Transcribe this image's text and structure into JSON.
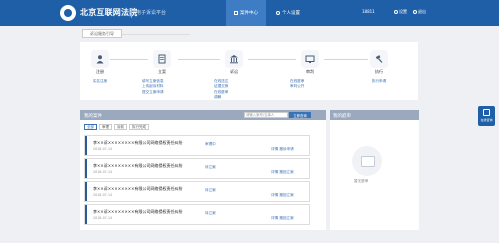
{
  "header": {
    "court_name": "北京互联网法院",
    "platform": "电子诉讼平台",
    "tabs": [
      "案件中心",
      "个人设置"
    ],
    "account": "18811",
    "links": [
      "设置",
      "退出"
    ]
  },
  "guide": {
    "tab_label": "诉讼服务引导"
  },
  "steps": [
    {
      "title": "注册",
      "desc": "实名注册"
    },
    {
      "title": "立案",
      "desc": "填写立案信息\n上传起诉材料\n提交立案申请"
    },
    {
      "title": "诉讼",
      "desc": "在线送达\n证据交换\n在线庭审\n调解"
    },
    {
      "title": "审判",
      "desc": "在线庭审\n审判公开"
    },
    {
      "title": "执行",
      "desc": "执行申请"
    }
  ],
  "cases": {
    "title": "我的案件",
    "search_placeholder": "请输入案号/当事人",
    "search_button": "立即查询",
    "filters": [
      "全部",
      "审理",
      "诉前",
      "执行完成"
    ],
    "rows": [
      {
        "title": "李××诉××××××××有限公司网络侵权责任纠纷",
        "meta": "2018-07-14",
        "status": "审理中",
        "action": "详情  撤诉申请"
      },
      {
        "title": "李××诉××××××××有限公司网络侵权责任纠纷",
        "meta": "2018-07-14",
        "status": "待立案",
        "action": "详情  撤回立案"
      },
      {
        "title": "李××诉××××××××有限公司网络侵权责任纠纷",
        "meta": "2018-07-14",
        "status": "待立案",
        "action": "详情  撤回立案"
      },
      {
        "title": "李××诉××××××××有限公司网络侵权责任纠纷",
        "meta": "2018-07-14",
        "status": "待立案",
        "action": "详情  撤回立案"
      }
    ]
  },
  "hearing": {
    "title": "我的庭审",
    "empty_text": "暂无庭审"
  },
  "float_button": {
    "label": "在线咨询"
  },
  "colors": {
    "brand": "#1f5fa8",
    "panel_head": "#9aa9be",
    "link": "#3a72b8"
  }
}
